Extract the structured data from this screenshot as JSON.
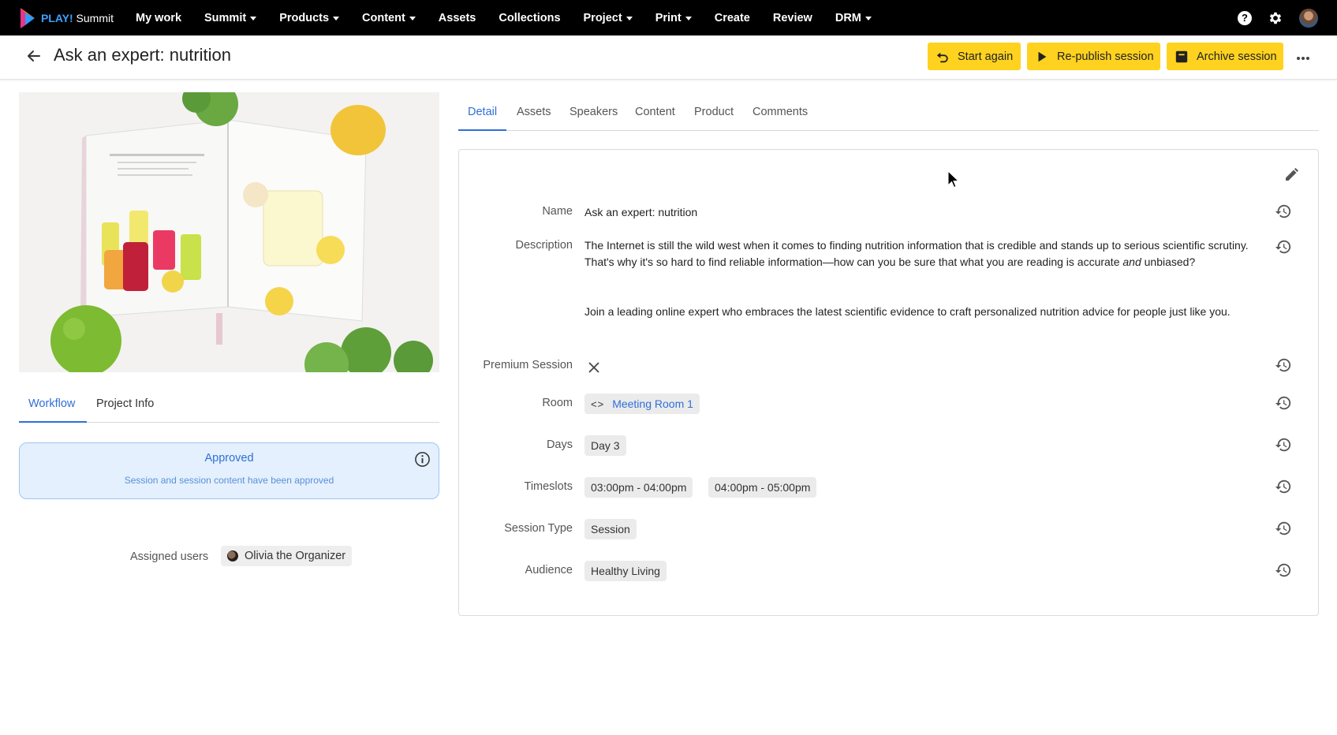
{
  "brand": {
    "play": "PLAY!",
    "name": "Summit"
  },
  "nav": {
    "items": [
      {
        "label": "My work",
        "dropdown": false
      },
      {
        "label": "Summit",
        "dropdown": true
      },
      {
        "label": "Products",
        "dropdown": true
      },
      {
        "label": "Content",
        "dropdown": true
      },
      {
        "label": "Assets",
        "dropdown": false
      },
      {
        "label": "Collections",
        "dropdown": false
      },
      {
        "label": "Project",
        "dropdown": true
      },
      {
        "label": "Print",
        "dropdown": true
      },
      {
        "label": "Create",
        "dropdown": false
      },
      {
        "label": "Review",
        "dropdown": false
      },
      {
        "label": "DRM",
        "dropdown": true
      }
    ],
    "help_glyph": "?"
  },
  "header": {
    "title": "Ask an expert: nutrition",
    "buttons": {
      "start_again": "Start again",
      "republish": "Re-publish session",
      "archive": "Archive session"
    }
  },
  "left_tabs": {
    "workflow": "Workflow",
    "project_info": "Project Info"
  },
  "status": {
    "title": "Approved",
    "subtitle": "Session and session content have been approved"
  },
  "assigned": {
    "label": "Assigned users",
    "user": "Olivia the Organizer"
  },
  "right_tabs": {
    "detail": "Detail",
    "assets": "Assets",
    "speakers": "Speakers",
    "content": "Content",
    "product": "Product",
    "comments": "Comments"
  },
  "detail": {
    "name_label": "Name",
    "name_value": "Ask an expert: nutrition",
    "description_label": "Description",
    "description_p1_a": "The Internet is still the wild west when it comes to finding nutrition information that is credible and stands up to serious scientific scrutiny. That's why it's so hard to find reliable information—how can you be sure that what you are reading is accurate ",
    "description_p1_em": "and",
    "description_p1_b": " unbiased?",
    "description_p2": "Join a leading online expert who embraces the latest scientific evidence to craft personalized nutrition advice for people just like you.",
    "premium_label": "Premium Session",
    "room_label": "Room",
    "room_code": "<>",
    "room_value": "Meeting Room 1",
    "days_label": "Days",
    "days_value": "Day 3",
    "timeslots_label": "Timeslots",
    "timeslots": [
      "03:00pm - 04:00pm",
      "04:00pm - 05:00pm"
    ],
    "session_type_label": "Session Type",
    "session_type_value": "Session",
    "audience_label": "Audience",
    "audience_value": "Healthy Living"
  },
  "colors": {
    "accent": "#2f6fd8",
    "action_yellow": "#ffd21f",
    "topbar": "#000000",
    "approved_bg": "#e4f0fd"
  }
}
